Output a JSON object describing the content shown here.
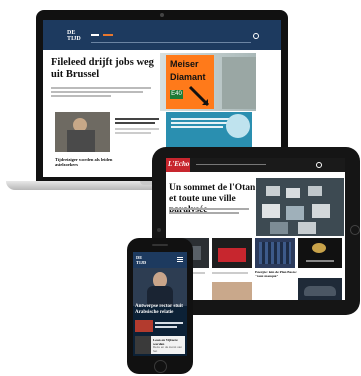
{
  "laptop": {
    "logo": "DE\nTIJD",
    "headline": "Fileleed drijft jobs weg uit Brussel",
    "sign_line1": "Meiser",
    "sign_line2": "Diamant",
    "sign_road": "E40",
    "bottom_headline": "Tijdreiziger worden als leiden",
    "bottom_headline2": "asielzoekers"
  },
  "tablet": {
    "logo": "L'Echo",
    "headline": "Un sommet de l'Otan et toute une ville paralysée",
    "thumb_caption": "Energie: loin de Plan Basto: \"taux manqué\""
  },
  "phone": {
    "logo": "DE\nTIJD",
    "headline": "Antwerpse rector stuit Arabsische relatie",
    "item_title": "Leon en Vijfeere worden",
    "item2": "Deze en de kunst van het"
  },
  "colors": {
    "accent_orange": "#e8772e",
    "sign_orange": "#ff7a1a",
    "navy": "#1d3a5f",
    "teal": "#2a8fb0",
    "echo_red": "#c7262e"
  }
}
